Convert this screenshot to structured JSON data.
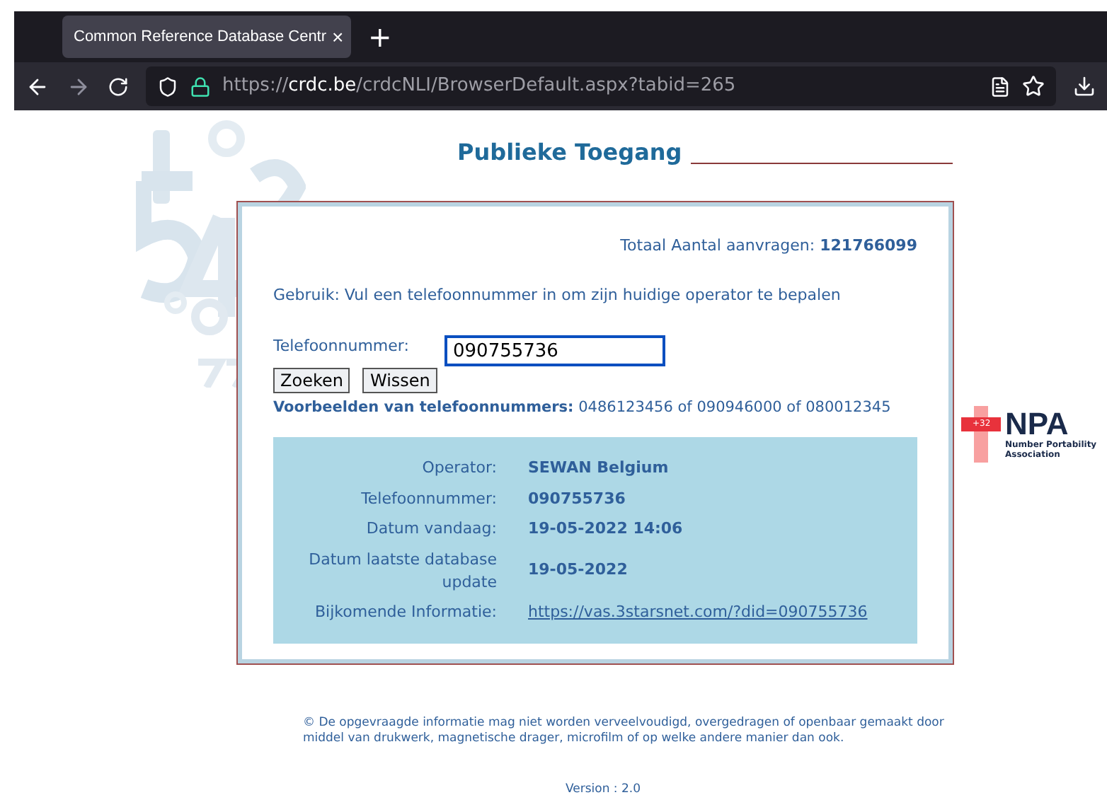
{
  "browser": {
    "tab_title": "Common Reference Database Centr",
    "tab_close": "×",
    "new_tab": "+",
    "url_prefix": "https://",
    "url_host": "crdc.be",
    "url_path": "/crdcNLI/BrowserDefault.aspx?tabid=265"
  },
  "title": "Publieke Toegang",
  "logo": {
    "badge": "+32",
    "name": "NPA",
    "subtitle": "Number Portability Association"
  },
  "total": {
    "label": "Totaal Aantal aanvragen:",
    "value": "121766099"
  },
  "usage": "Gebruik: Vul een telefoonnummer in om zijn huidige operator te bepalen",
  "phone_field": {
    "label": "Telefoonnummer:",
    "value": "090755736"
  },
  "buttons": [
    "Zoeken",
    "Wissen"
  ],
  "examples": {
    "label": "Voorbeelden van telefoonnummers:",
    "value": "0486123456 of 090946000 of 080012345"
  },
  "results": [
    {
      "kind": "text",
      "label": "Operator:",
      "value": "SEWAN Belgium"
    },
    {
      "kind": "text",
      "label": "Telefoonnummer:",
      "value": "090755736"
    },
    {
      "kind": "text",
      "label": "Datum vandaag:",
      "value": "19-05-2022 14:06"
    },
    {
      "kind": "text",
      "label": "Datum laatste database update",
      "value": "19-05-2022"
    },
    {
      "kind": "link",
      "label": "Bijkomende Informatie:",
      "value": "https://vas.3starsnet.com/?did=090755736"
    }
  ],
  "footer": "© De opgevraagde informatie mag niet worden verveelvoudigd, overgedragen of openbaar gemaakt door middel van drukwerk, magnetische drager, microfilm of op welke andere manier dan ook.",
  "version": "Version : 2.0"
}
